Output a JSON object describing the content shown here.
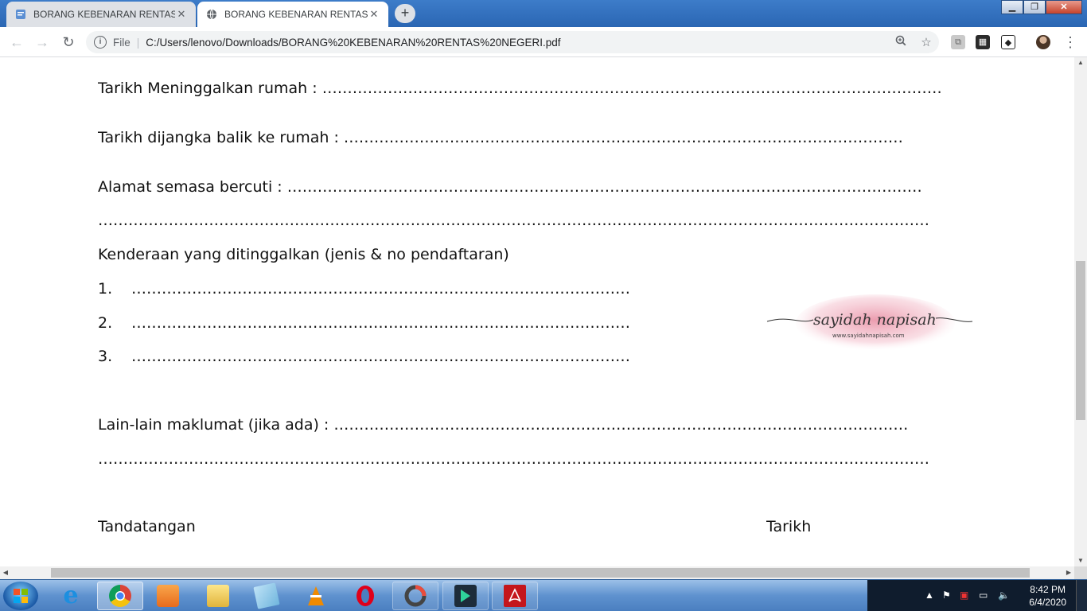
{
  "browser": {
    "tabs": [
      {
        "title": "BORANG KEBENARAN RENTAS N",
        "favicon": "document-favicon-icon",
        "active": false,
        "close": "✕"
      },
      {
        "title": "BORANG KEBENARAN RENTAS N",
        "favicon": "globe-icon",
        "active": true,
        "close": "✕"
      }
    ],
    "new_tab": "+",
    "window_controls": {
      "minimize": "▁",
      "maximize": "❐",
      "close": "✕"
    },
    "nav": {
      "back": "←",
      "forward": "→",
      "reload": "↻"
    },
    "address": {
      "scheme_label": "File",
      "url": "C:/Users/lenovo/Downloads/BORANG%20KEBENARAN%20RENTAS%20NEGERI.pdf"
    },
    "toolbar_icons": [
      "zoom-icon",
      "bookmark-star-icon",
      "pdf-extension-icon",
      "extension-icon",
      "cube-extension-icon",
      "profile-avatar",
      "menu-kebab-icon"
    ]
  },
  "document": {
    "tarikh_meninggalkan": "Tarikh Meninggalkan rumah : ……………………………………………………………………………………………………………",
    "tarikh_dijangka": "Tarikh dijangka balik ke rumah : …………………………………………………………………………………………………",
    "alamat": "Alamat semasa bercuti   :  ………………………………………………………………………………………………………………",
    "alamat_cont": "…………………………………………………………………………………………………………………………………………………",
    "kenderaan_heading": "Kenderaan yang ditinggalkan (jenis & no pendaftaran)",
    "kenderaan_items": [
      {
        "num": "1.",
        "line": "………………………………………………………………………………………"
      },
      {
        "num": "2.",
        "line": "………………………………………………………………………………………"
      },
      {
        "num": "3.",
        "line": "………………………………………………………………………………………"
      }
    ],
    "lain_lain": "Lain-lain maklumat (jika ada) : ……………………………………………………………………………………………………",
    "lain_lain_cont": "…………………………………………………………………………………………………………………………………………………",
    "tandatangan": "Tandatangan",
    "tarikh": "Tarikh",
    "watermark_name": "sayidah napisah",
    "watermark_url": "www.sayidahnapisah.com"
  },
  "taskbar": {
    "apps": [
      "chrome",
      "internet-explorer",
      "media-player",
      "file-explorer",
      "notepad",
      "vlc",
      "opera",
      "recording-app",
      "filmora",
      "acrobat"
    ],
    "clock_time": "8:42 PM",
    "clock_date": "6/4/2020"
  },
  "colors": {
    "tabstrip": "#2a66b3",
    "watermark_pink": "#e88aa0",
    "acrobat_red": "#c4161c",
    "opera_red": "#e0001a"
  }
}
